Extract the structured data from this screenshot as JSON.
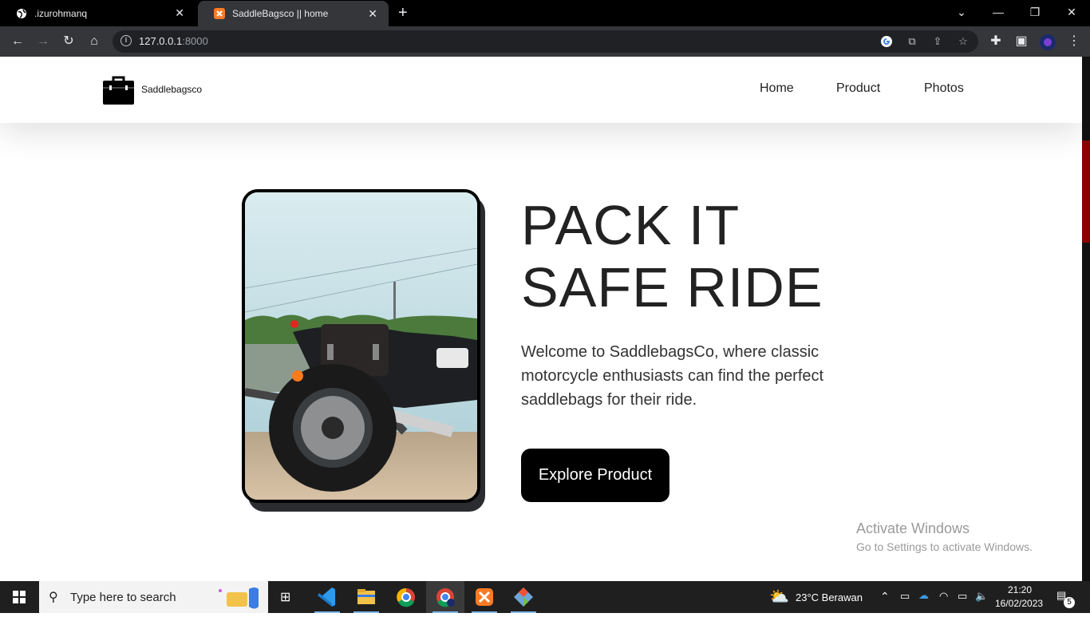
{
  "browser": {
    "tabs": [
      {
        "title": ".izurohmanq",
        "active": false
      },
      {
        "title": "SaddleBagsco || home",
        "active": true
      }
    ],
    "url_host": "127.0.0.1",
    "url_port": ":8000"
  },
  "site": {
    "brand": "Saddlebagsco",
    "nav": [
      "Home",
      "Product",
      "Photos"
    ],
    "hero": {
      "title_line1": "PACK IT",
      "title_line2": "SAFE RIDE",
      "text": "Welcome to SaddlebagsCo, where classic motorcycle enthusiasts can find the perfect saddlebags for their ride.",
      "button": "Explore Product"
    }
  },
  "watermark": {
    "line1": "Activate Windows",
    "line2": "Go to Settings to activate Windows."
  },
  "taskbar": {
    "search_placeholder": "Type here to search",
    "weather": "23°C  Berawan",
    "time": "21:20",
    "date": "16/02/2023",
    "notifications": "5"
  },
  "colors": {
    "accent": "#000000",
    "scroll_thumb": "#8b0000"
  }
}
